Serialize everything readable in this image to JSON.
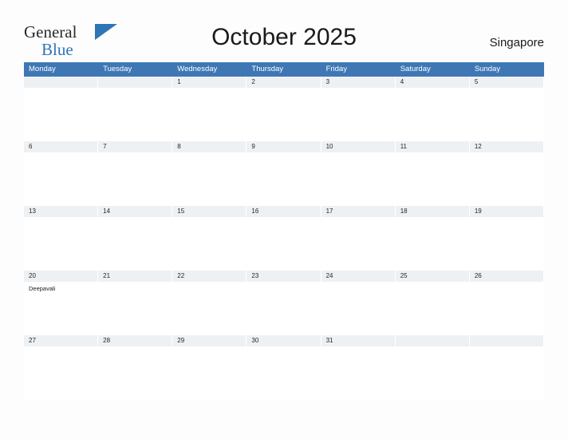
{
  "brand": {
    "general": "General",
    "blue": "Blue",
    "flag_icon": "flag-icon"
  },
  "header": {
    "title": "October 2025",
    "region": "Singapore"
  },
  "calendar": {
    "day_headers": [
      "Monday",
      "Tuesday",
      "Wednesday",
      "Thursday",
      "Friday",
      "Saturday",
      "Sunday"
    ],
    "accent_color": "#3f77b5",
    "band_color": "#eef1f4",
    "weeks": [
      [
        {
          "day": ""
        },
        {
          "day": ""
        },
        {
          "day": "1"
        },
        {
          "day": "2"
        },
        {
          "day": "3"
        },
        {
          "day": "4"
        },
        {
          "day": "5"
        }
      ],
      [
        {
          "day": "6"
        },
        {
          "day": "7"
        },
        {
          "day": "8"
        },
        {
          "day": "9"
        },
        {
          "day": "10"
        },
        {
          "day": "11"
        },
        {
          "day": "12"
        }
      ],
      [
        {
          "day": "13"
        },
        {
          "day": "14"
        },
        {
          "day": "15"
        },
        {
          "day": "16"
        },
        {
          "day": "17"
        },
        {
          "day": "18"
        },
        {
          "day": "19"
        }
      ],
      [
        {
          "day": "20",
          "event": "Deepavali"
        },
        {
          "day": "21"
        },
        {
          "day": "22"
        },
        {
          "day": "23"
        },
        {
          "day": "24"
        },
        {
          "day": "25"
        },
        {
          "day": "26"
        }
      ],
      [
        {
          "day": "27"
        },
        {
          "day": "28"
        },
        {
          "day": "29"
        },
        {
          "day": "30"
        },
        {
          "day": "31"
        },
        {
          "day": ""
        },
        {
          "day": ""
        }
      ]
    ]
  }
}
